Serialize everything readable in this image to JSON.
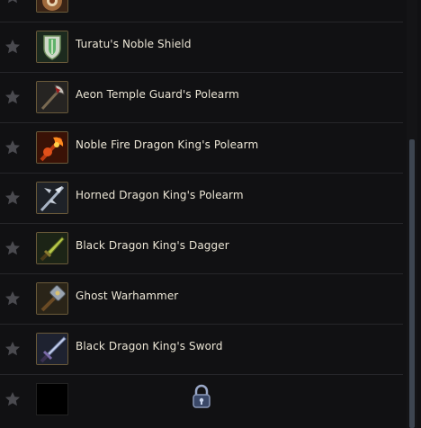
{
  "items": [
    {
      "name": "",
      "icon": "shield-ornament-icon"
    },
    {
      "name": "Turatu's Noble Shield",
      "icon": "shield-icon"
    },
    {
      "name": "Aeon Temple Guard's Polearm",
      "icon": "polearm-icon"
    },
    {
      "name": "Noble Fire Dragon King's Polearm",
      "icon": "fire-polearm-icon"
    },
    {
      "name": "Horned Dragon King's Polearm",
      "icon": "horned-polearm-icon"
    },
    {
      "name": "Black Dragon King's Dagger",
      "icon": "dagger-icon"
    },
    {
      "name": "Ghost Warhammer",
      "icon": "warhammer-icon"
    },
    {
      "name": "Black Dragon King's Sword",
      "icon": "sword-icon"
    }
  ],
  "locked_slot": {
    "icon": "lock-icon"
  },
  "colors": {
    "background": "#111113",
    "row_border": "#26262a",
    "star": "#4a4a4f",
    "text": "#ece6d6",
    "scroll_thumb": "#3d4550"
  }
}
